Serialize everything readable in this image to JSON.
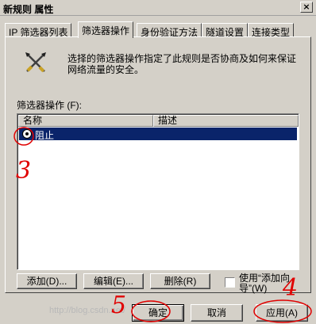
{
  "window": {
    "title": "新规则 属性",
    "close_label": "×"
  },
  "tabs": [
    {
      "label": "IP 筛选器列表",
      "active": false
    },
    {
      "label": "筛选器操作",
      "active": true
    },
    {
      "label": "身份验证方法",
      "active": false
    },
    {
      "label": "隧道设置",
      "active": false
    },
    {
      "label": "连接类型",
      "active": false
    }
  ],
  "info": {
    "text": "选择的筛选器操作指定了此规则是否协商及如何来保证网络流量的安全。",
    "icon": "tools-icon"
  },
  "list": {
    "label": "筛选器操作 (F):",
    "columns": [
      "名称",
      "描述"
    ],
    "rows": [
      {
        "name": "阻止",
        "description": "",
        "selected": true
      }
    ]
  },
  "buttons": {
    "add": "添加(D)...",
    "edit": "编辑(E)...",
    "remove": "删除(R)",
    "ok": "确定",
    "cancel": "取消",
    "apply": "应用(A)"
  },
  "wizard_checkbox": {
    "label": "使用“添加向导”(W)",
    "checked": false
  },
  "annotations": {
    "color": "#e00000",
    "labels": [
      "3",
      "4",
      "5"
    ]
  },
  "watermark": "http://blog.csdn.net/"
}
